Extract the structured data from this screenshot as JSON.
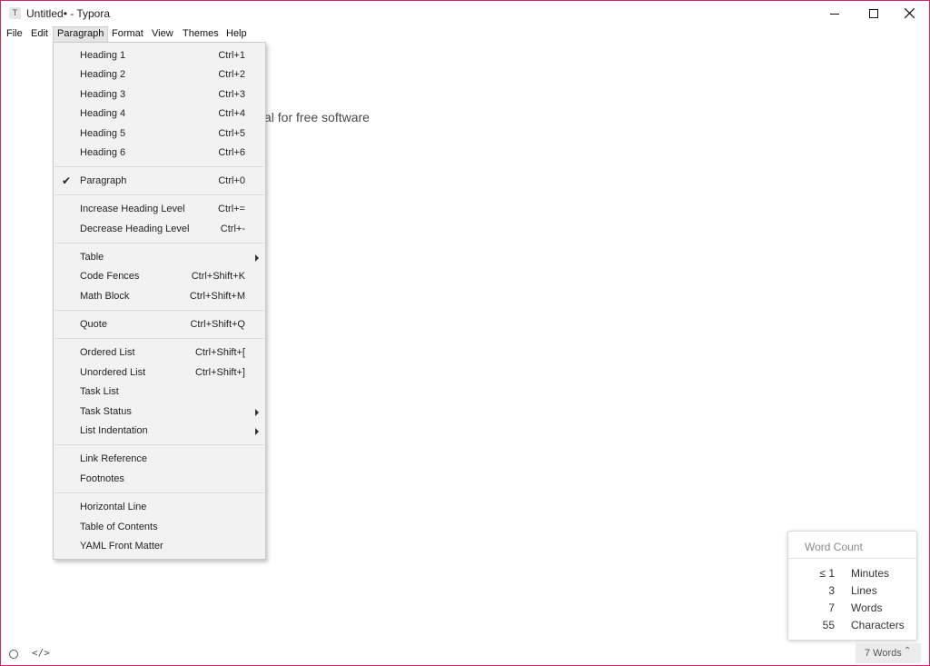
{
  "window": {
    "title": "Untitled• - Typora",
    "app_icon": "T"
  },
  "menubar": {
    "items": [
      "File",
      "Edit",
      "Paragraph",
      "Format",
      "View",
      "Themes",
      "Help"
    ],
    "active": "Paragraph"
  },
  "editor": {
    "visible_text": "al for free software"
  },
  "paragraph_menu": {
    "items": [
      {
        "label": "Heading 1",
        "shortcut": "Ctrl+1"
      },
      {
        "label": "Heading 2",
        "shortcut": "Ctrl+2"
      },
      {
        "label": "Heading 3",
        "shortcut": "Ctrl+3"
      },
      {
        "label": "Heading 4",
        "shortcut": "Ctrl+4"
      },
      {
        "label": "Heading 5",
        "shortcut": "Ctrl+5"
      },
      {
        "label": "Heading 6",
        "shortcut": "Ctrl+6"
      },
      {
        "label": "Paragraph",
        "shortcut": "Ctrl+0",
        "checked": true
      },
      {
        "label": "Increase Heading Level",
        "shortcut": "Ctrl+="
      },
      {
        "label": "Decrease Heading Level",
        "shortcut": "Ctrl+-"
      },
      {
        "label": "Table",
        "submenu": true
      },
      {
        "label": "Code Fences",
        "shortcut": "Ctrl+Shift+K"
      },
      {
        "label": "Math Block",
        "shortcut": "Ctrl+Shift+M"
      },
      {
        "label": "Quote",
        "shortcut": "Ctrl+Shift+Q"
      },
      {
        "label": "Ordered List",
        "shortcut": "Ctrl+Shift+["
      },
      {
        "label": "Unordered List",
        "shortcut": "Ctrl+Shift+]"
      },
      {
        "label": "Task List"
      },
      {
        "label": "Task Status",
        "submenu": true
      },
      {
        "label": "List Indentation",
        "submenu": true
      },
      {
        "label": "Link Reference"
      },
      {
        "label": "Footnotes"
      },
      {
        "label": "Horizontal Line"
      },
      {
        "label": "Table of Contents"
      },
      {
        "label": "YAML Front Matter"
      }
    ]
  },
  "word_count_popup": {
    "title": "Word Count",
    "rows": [
      {
        "value": "≤ 1",
        "label": "Minutes"
      },
      {
        "value": "3",
        "label": "Lines"
      },
      {
        "value": "7",
        "label": "Words"
      },
      {
        "value": "55",
        "label": "Characters"
      }
    ]
  },
  "statusbar": {
    "word_count_label": "7 Words",
    "source_code_glyph": "</>"
  }
}
